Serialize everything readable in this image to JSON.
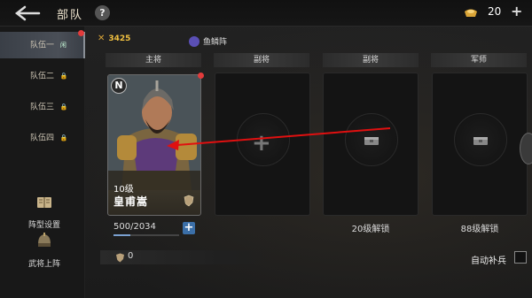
{
  "header": {
    "title": "部队",
    "help_label": "?",
    "currency_icon": "gold-ingot-icon",
    "currency_value": "20",
    "add_label": "+"
  },
  "sidebar": {
    "tabs": [
      {
        "label": "队伍一",
        "mark": "闲",
        "active": true
      },
      {
        "label": "队伍二",
        "mark": "🔒"
      },
      {
        "label": "队伍三",
        "mark": "🔒"
      },
      {
        "label": "队伍四",
        "mark": "🔒"
      }
    ],
    "actions": [
      {
        "label": "阵型设置",
        "icon": "book-icon"
      },
      {
        "label": "武将上阵",
        "icon": "helmet-icon"
      }
    ]
  },
  "stats": {
    "power_value": "3425",
    "formation_name": "鱼鳞阵"
  },
  "columns": [
    {
      "header": "主将"
    },
    {
      "header": "副将",
      "slot_symbol": "+"
    },
    {
      "header": "副将",
      "unlock_text": "20级解锁"
    },
    {
      "header": "军师",
      "unlock_text": "88级解锁"
    }
  ],
  "hero": {
    "grade": "N",
    "level": "10级",
    "name": "皇甫嵩",
    "troops": "500/2034",
    "troop_fraction": 0.25,
    "add_troops_label": "+"
  },
  "bottom": {
    "count": "0",
    "auto_label": "自动补兵"
  },
  "colors": {
    "accent_gold": "#f0c040",
    "notify_red": "#e23b3b",
    "add_blue": "#3b6fa8",
    "annotation_red": "#e01010"
  }
}
